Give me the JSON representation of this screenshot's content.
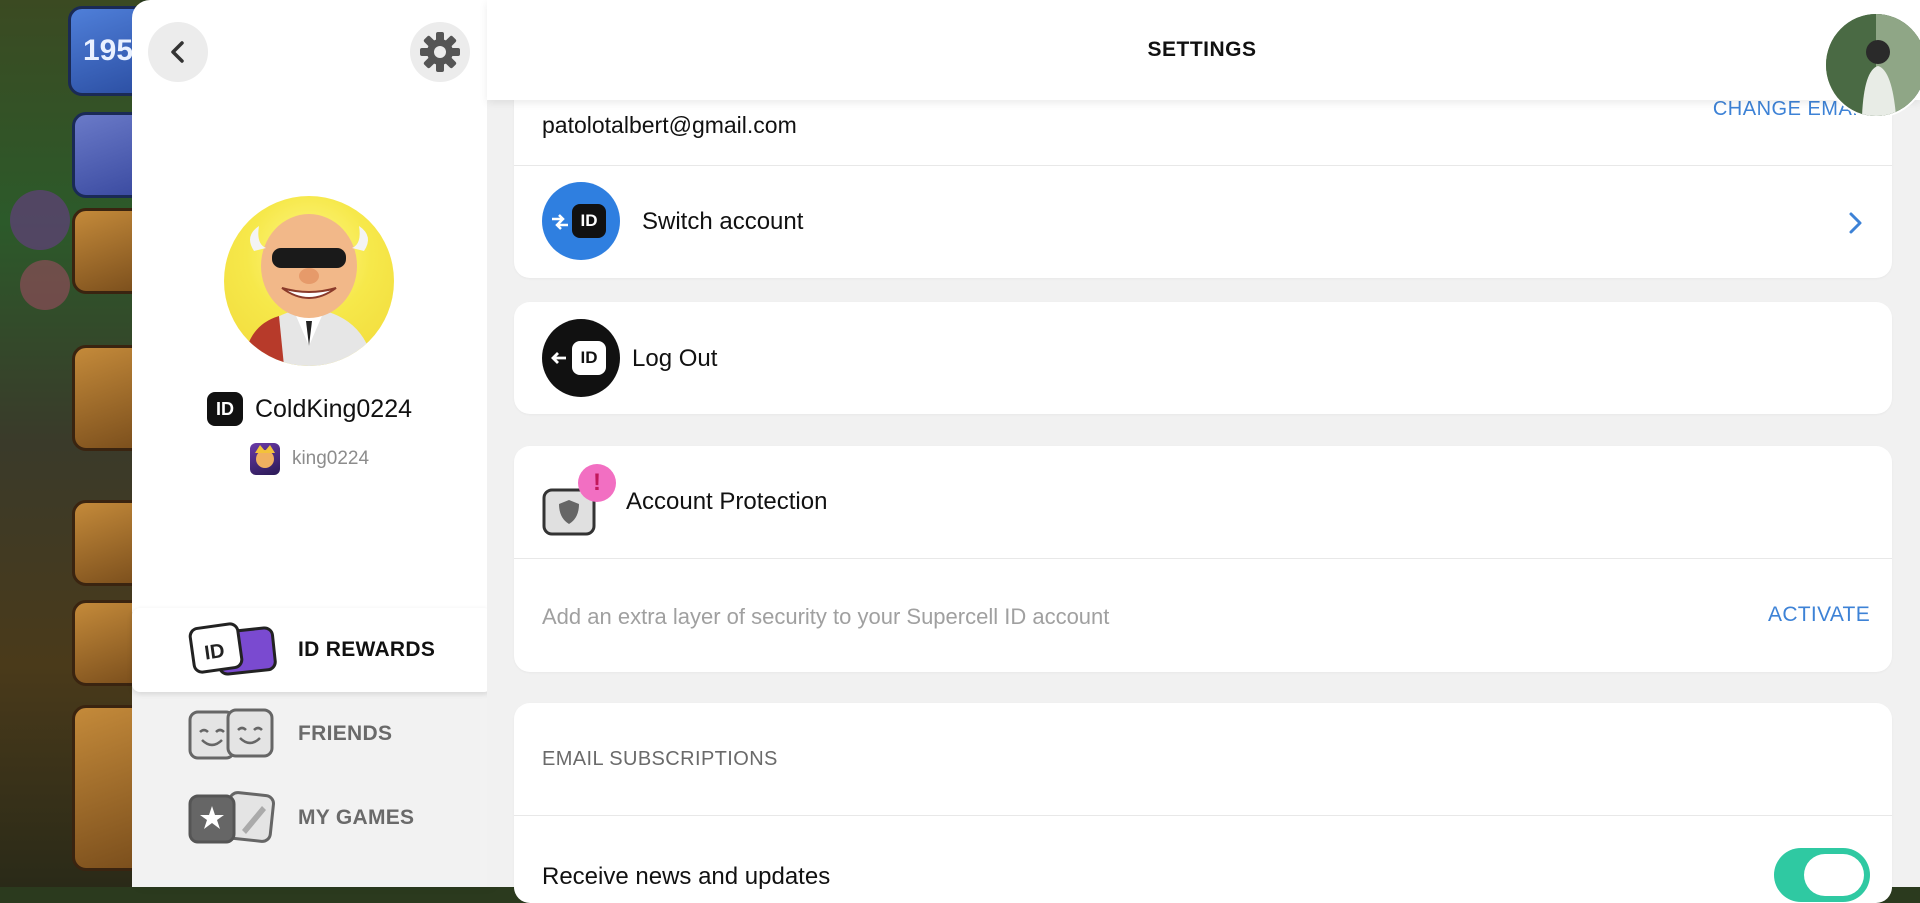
{
  "header": {
    "title": "SETTINGS"
  },
  "profile": {
    "username": "ColdKing0224",
    "id_chip": "ID",
    "game_tag": "king0224"
  },
  "nav": [
    {
      "label": "ID REWARDS",
      "active": true
    },
    {
      "label": "FRIENDS",
      "active": false
    },
    {
      "label": "MY GAMES",
      "active": false
    }
  ],
  "account": {
    "email": "patolotalbert@gmail.com",
    "change_email": "CHANGE EMAIL",
    "switch_account": "Switch account",
    "logout": "Log Out",
    "id_icon_text": "ID"
  },
  "protection": {
    "title": "Account Protection",
    "description": "Add an extra layer of security to your Supercell ID account",
    "action": "ACTIVATE",
    "alert_mark": "!"
  },
  "subscriptions": {
    "title": "EMAIL SUBSCRIPTIONS",
    "news_label": "Receive news and updates",
    "news_enabled": true
  },
  "game_badge": "195",
  "colors": {
    "link": "#3d82d6",
    "toggle_on": "#2fc9a2",
    "switch_icon_bg": "#2f7fe0",
    "alert_pink": "#f26fc2"
  },
  "icons": {
    "back": "chevron-left-icon",
    "settings": "gear-icon",
    "chevron": "chevron-right-icon"
  }
}
